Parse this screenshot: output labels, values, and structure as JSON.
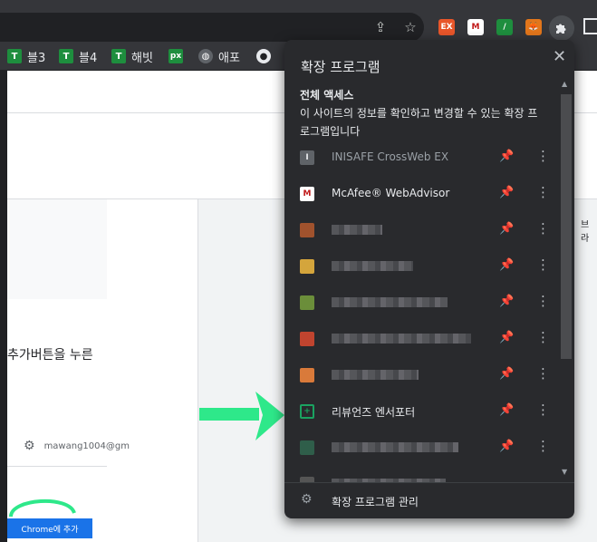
{
  "toolbar": {
    "share_icon": "share-icon",
    "star_icon": "star-icon",
    "extensions": [
      {
        "name": "ex-extension-icon",
        "label": "EX",
        "color": "#e8562a"
      },
      {
        "name": "mcafee-icon",
        "label": "M",
        "color": "#c01818"
      },
      {
        "name": "green-slash-icon",
        "label": "/",
        "color": "#1e8e3e"
      },
      {
        "name": "metamask-icon",
        "label": "",
        "color": "#e2761b"
      }
    ],
    "puzzle_icon": "puzzle-icon"
  },
  "bookmarks": [
    {
      "label": "블3",
      "color": "#1e8e3e",
      "icon": "T"
    },
    {
      "label": "블4",
      "color": "#1e8e3e",
      "icon": "T"
    },
    {
      "label": "해빗",
      "color": "#1e8e3e",
      "icon": "T"
    },
    {
      "label": "",
      "color": "#1e8e3e",
      "icon": "px"
    },
    {
      "label": "애포",
      "color": "#5f6368",
      "icon": "globe"
    },
    {
      "label": "",
      "color": "#e8eaed",
      "icon": "dot"
    }
  ],
  "page": {
    "instruction_text": "추가버튼을 누른",
    "account_email": "mawang1004@gm",
    "add_button_label": "Chrome에 추가",
    "side_label": "브라"
  },
  "menu": {
    "title": "확장 프로그램",
    "access_heading": "전체 액세스",
    "access_description": "이 사이트의 정보를 확인하고 변경할 수 있는 확장 프로그램입니다",
    "extensions": [
      {
        "name": "INISAFE CrossWeb EX",
        "pinned": false,
        "dim": true,
        "icon_color": "#5f6368",
        "icon_label": "I"
      },
      {
        "name": "McAfee® WebAdvisor",
        "pinned": true,
        "dim": false,
        "icon_color": "#ffffff",
        "icon_label": "M"
      },
      {
        "name": "",
        "pinned": true,
        "dim": false,
        "icon_color": "#a0522d",
        "icon_label": ""
      },
      {
        "name": "",
        "pinned": false,
        "dim": false,
        "icon_color": "#d4a53c",
        "icon_label": ""
      },
      {
        "name": "",
        "pinned": false,
        "dim": false,
        "icon_color": "#6b8e3a",
        "icon_label": ""
      },
      {
        "name": "",
        "pinned": false,
        "dim": false,
        "icon_color": "#c0442f",
        "icon_label": ""
      },
      {
        "name": "",
        "pinned": true,
        "dim": false,
        "icon_color": "#d97a3a",
        "icon_label": ""
      },
      {
        "name": "리뷰언즈 엔서포터",
        "pinned": false,
        "dim": false,
        "icon_color": "#1aa260",
        "icon_label": "+"
      },
      {
        "name": "",
        "pinned": true,
        "dim": false,
        "icon_color": "#2f5e4a",
        "icon_label": ""
      },
      {
        "name": "",
        "pinned": false,
        "dim": false,
        "icon_color": "#555555",
        "icon_label": ""
      }
    ],
    "footer_label": "확장 프로그램 관리"
  }
}
